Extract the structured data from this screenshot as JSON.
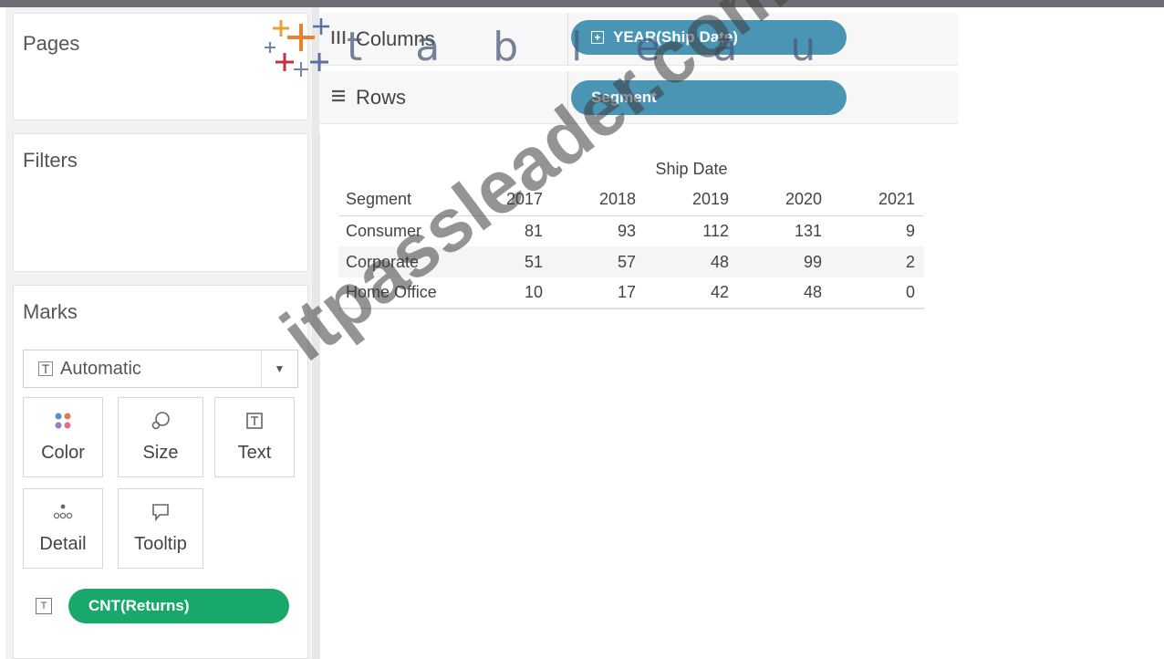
{
  "panels": {
    "pages": "Pages",
    "filters": "Filters",
    "marks": "Marks"
  },
  "shelves": {
    "columns_label": "Columns",
    "columns_pill": "YEAR(Ship Date)",
    "rows_label": "Rows",
    "rows_pill": "Segment"
  },
  "marks": {
    "type": "Automatic",
    "buttons": {
      "color": "Color",
      "size": "Size",
      "text": "Text",
      "detail": "Detail",
      "tooltip": "Tooltip"
    },
    "field_pill": "CNT(Returns)"
  },
  "crosstab": {
    "column_header": "Ship Date",
    "row_header": "Segment",
    "years": [
      "2017",
      "2018",
      "2019",
      "2020",
      "2021"
    ],
    "rows": [
      {
        "segment": "Consumer",
        "values": [
          "81",
          "93",
          "112",
          "131",
          "9"
        ]
      },
      {
        "segment": "Corporate",
        "values": [
          "51",
          "57",
          "48",
          "99",
          "2"
        ]
      },
      {
        "segment": "Home Office",
        "values": [
          "10",
          "17",
          "42",
          "48",
          "0"
        ]
      }
    ]
  },
  "branding": {
    "logo_text": "t a b l e a u",
    "watermark": "itpassleader.com"
  },
  "colors": {
    "blue_pill": "#4a95b4",
    "green_pill": "#18a86b"
  }
}
